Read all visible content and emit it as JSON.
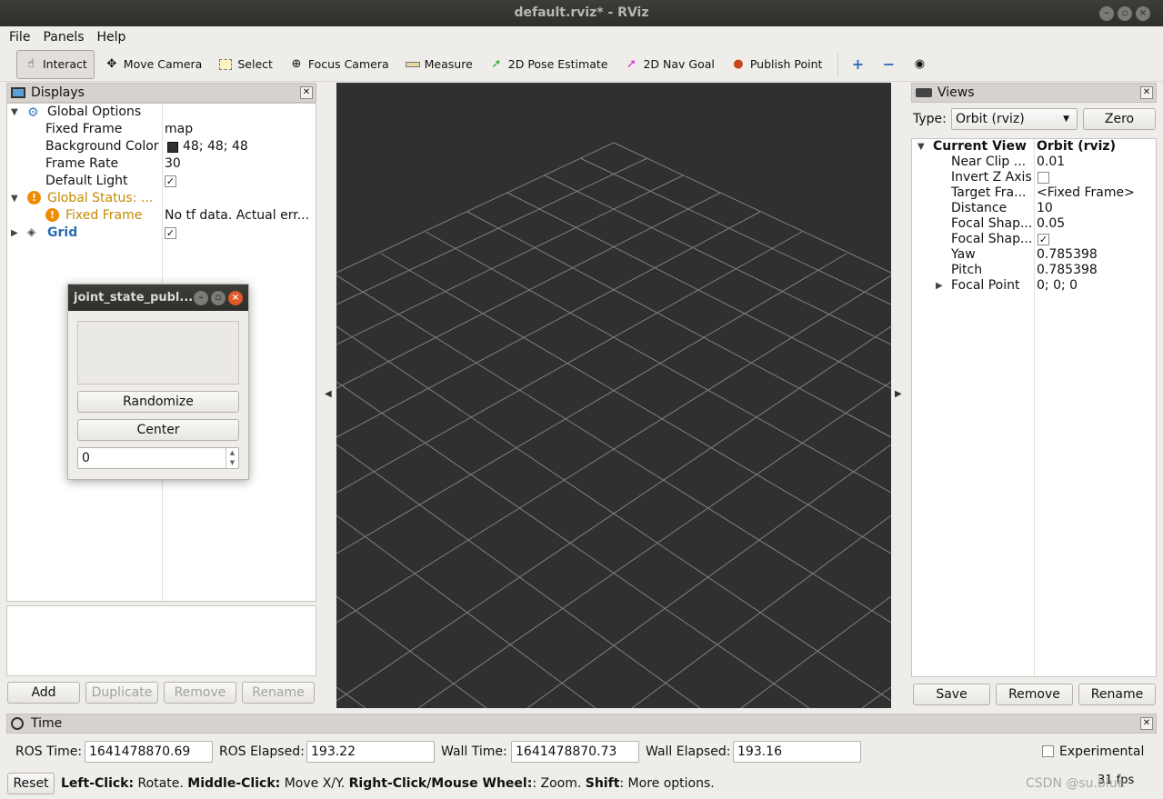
{
  "window": {
    "title": "default.rviz* - RViz"
  },
  "menu": {
    "file": "File",
    "panels": "Panels",
    "help": "Help"
  },
  "toolbar": {
    "interact": "Interact",
    "move_camera": "Move Camera",
    "select": "Select",
    "focus_camera": "Focus Camera",
    "measure": "Measure",
    "pose_estimate": "2D Pose Estimate",
    "nav_goal": "2D Nav Goal",
    "publish_point": "Publish Point"
  },
  "displays": {
    "title": "Displays",
    "global_options": "Global Options",
    "fixed_frame_label": "Fixed Frame",
    "fixed_frame_value": "map",
    "bg_color_label": "Background Color",
    "bg_color_value": "48; 48; 48",
    "frame_rate_label": "Frame Rate",
    "frame_rate_value": "30",
    "default_light_label": "Default Light",
    "global_status_label": "Global Status: ...",
    "status_fixed_frame_label": "Fixed Frame",
    "status_fixed_frame_value": "No tf data.  Actual err...",
    "grid_label": "Grid",
    "buttons": {
      "add": "Add",
      "duplicate": "Duplicate",
      "remove": "Remove",
      "rename": "Rename"
    }
  },
  "joint_window": {
    "title": "joint_state_publ...",
    "randomize": "Randomize",
    "center": "Center",
    "value": "0"
  },
  "views": {
    "title": "Views",
    "type_label": "Type:",
    "type_value": "Orbit (rviz)",
    "zero": "Zero",
    "current_view_label": "Current View",
    "current_view_value": "Orbit (rviz)",
    "near_clip_label": "Near Clip ...",
    "near_clip_value": "0.01",
    "invert_z_label": "Invert Z Axis",
    "target_frame_label": "Target Fra...",
    "target_frame_value": "<Fixed Frame>",
    "distance_label": "Distance",
    "distance_value": "10",
    "focal_shape_size_label": "Focal Shap...",
    "focal_shape_size_value": "0.05",
    "focal_shape_fixed_label": "Focal Shap...",
    "yaw_label": "Yaw",
    "yaw_value": "0.785398",
    "pitch_label": "Pitch",
    "pitch_value": "0.785398",
    "focal_point_label": "Focal Point",
    "focal_point_value": "0; 0; 0",
    "buttons": {
      "save": "Save",
      "remove": "Remove",
      "rename": "Rename"
    }
  },
  "time": {
    "title": "Time",
    "ros_time_label": "ROS Time:",
    "ros_time_value": "1641478870.69",
    "ros_elapsed_label": "ROS Elapsed:",
    "ros_elapsed_value": "193.22",
    "wall_time_label": "Wall Time:",
    "wall_time_value": "1641478870.73",
    "wall_elapsed_label": "Wall Elapsed:",
    "wall_elapsed_value": "193.16",
    "experimental": "Experimental"
  },
  "status": {
    "reset": "Reset",
    "left_click": "Left-Click:",
    "left_click_desc": " Rotate. ",
    "middle_click": "Middle-Click:",
    "middle_click_desc": " Move X/Y. ",
    "right_click": "Right-Click/Mouse Wheel:",
    "right_click_desc": ": Zoom. ",
    "shift": "Shift",
    "shift_desc": ": More options.",
    "fps": "31 fps",
    "watermark": "CSDN @su.blue"
  },
  "colors": {
    "viewport_bg": "#303030",
    "grid_line": "#a0a0a0",
    "warning": "#c58a00",
    "grid_blue": "#2b6cb0"
  }
}
